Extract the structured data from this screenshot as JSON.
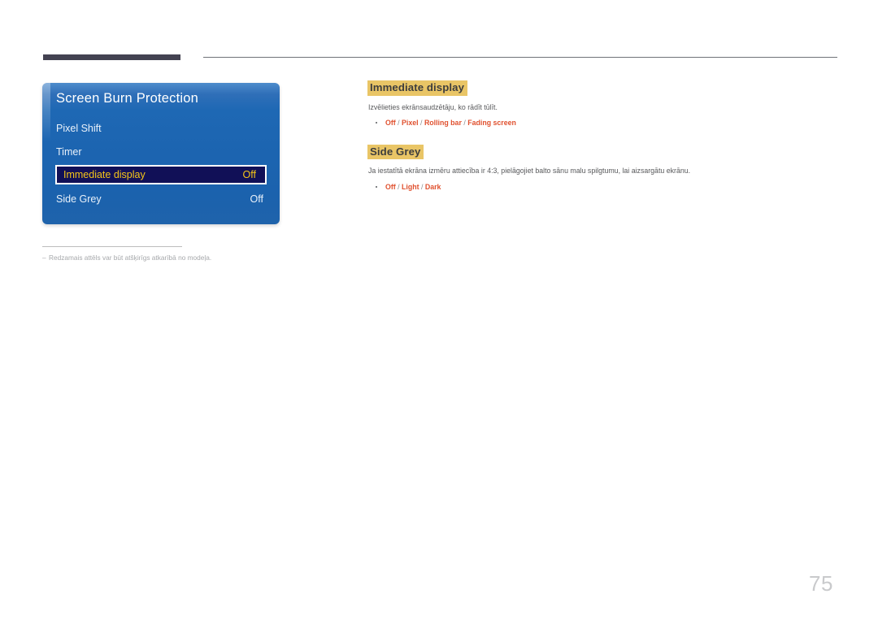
{
  "header": {
    "tab_marker": "",
    "rule": ""
  },
  "osd": {
    "title": "Screen Burn Protection",
    "rows": [
      {
        "label": "Pixel Shift",
        "value": ""
      },
      {
        "label": "Timer",
        "value": ""
      },
      {
        "label": "Immediate display",
        "value": "Off",
        "selected": true
      },
      {
        "label": "Side Grey",
        "value": "Off"
      }
    ]
  },
  "footnote": {
    "dash": "–",
    "text": "Redzamais attēls var būt atšķirīgs atkarībā no modeļa."
  },
  "content": {
    "sections": [
      {
        "heading": "Immediate display",
        "description": "Izvēlieties ekrānsaudzētāju, ko rādīt tūlīt.",
        "options": [
          {
            "opt1": "Off",
            "sep1": " / ",
            "opt2": "Pixel",
            "sep2": " / ",
            "opt3": "Rolling bar",
            "sep3": " / ",
            "opt4": "Fading screen"
          }
        ]
      },
      {
        "heading": "Side Grey",
        "description": "Ja iestatītā ekrāna izmēru attiecība ir 4:3, pielāgojiet balto sānu malu spilgtumu, lai aizsargātu ekrānu.",
        "options": [
          {
            "opt1": "Off",
            "sep1": " / ",
            "opt2": "Light",
            "sep2": " / ",
            "opt3": "Dark"
          }
        ]
      }
    ]
  },
  "page_number": "75",
  "colors": {
    "osd_blue": "#1c64b0",
    "osd_selected_bg": "#111057",
    "osd_selected_text": "#f5c518",
    "heading_highlight": "#e9c566",
    "option_accent": "#e0512f",
    "header_tab": "#434251",
    "page_number": "#c9cacc"
  }
}
